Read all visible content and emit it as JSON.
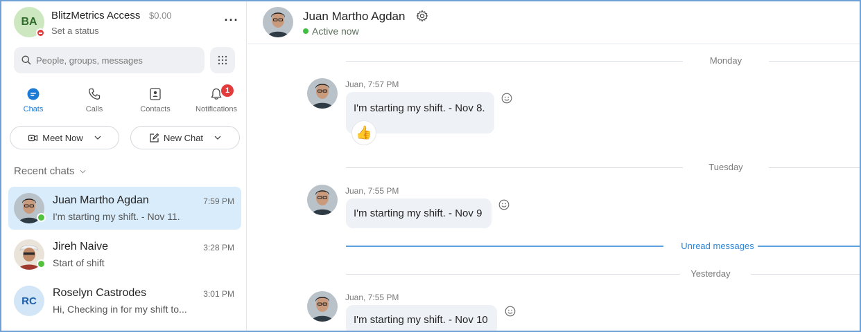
{
  "profile": {
    "initials": "BA",
    "name": "BlitzMetrics Access",
    "balance": "$0.00",
    "status": "Set a status"
  },
  "search": {
    "placeholder": "People, groups, messages"
  },
  "nav": [
    {
      "label": "Chats",
      "icon": "chat-icon",
      "active": true
    },
    {
      "label": "Calls",
      "icon": "phone-icon"
    },
    {
      "label": "Contacts",
      "icon": "contacts-icon"
    },
    {
      "label": "Notifications",
      "icon": "bell-icon",
      "badge": "1"
    }
  ],
  "actions": {
    "meet_now": "Meet Now",
    "new_chat": "New Chat"
  },
  "recent_chats": {
    "header": "Recent chats",
    "items": [
      {
        "name": "Juan Martho Agdan",
        "time": "7:59 PM",
        "preview": "I'm starting my shift. - Nov 11.",
        "presence": "online"
      },
      {
        "name": "Jireh Naive",
        "time": "3:28 PM",
        "preview": "Start of shift",
        "presence": "online"
      },
      {
        "name": "Roselyn Castrodes",
        "time": "3:01 PM",
        "preview": "Hi, Checking in for my shift to...",
        "initials": "RC"
      }
    ]
  },
  "conversation": {
    "contact_name": "Juan Martho Agdan",
    "status": "Active now",
    "dividers": {
      "monday": "Monday",
      "tuesday": "Tuesday",
      "unread": "Unread messages",
      "yesterday": "Yesterday"
    },
    "messages": [
      {
        "meta": "Juan, 7:57 PM",
        "text": "I'm starting my shift. - Nov 8.",
        "reaction": "👍"
      },
      {
        "meta": "Juan, 7:55 PM",
        "text": "I'm starting my shift. - Nov 9"
      },
      {
        "meta": "Juan, 7:55 PM",
        "text": "I'm starting my shift. - Nov 10"
      }
    ]
  },
  "colors": {
    "accent": "#1d7bd6",
    "selected_row": "#d8ecfb",
    "online": "#52c23f",
    "badge": "#e23b3b"
  }
}
